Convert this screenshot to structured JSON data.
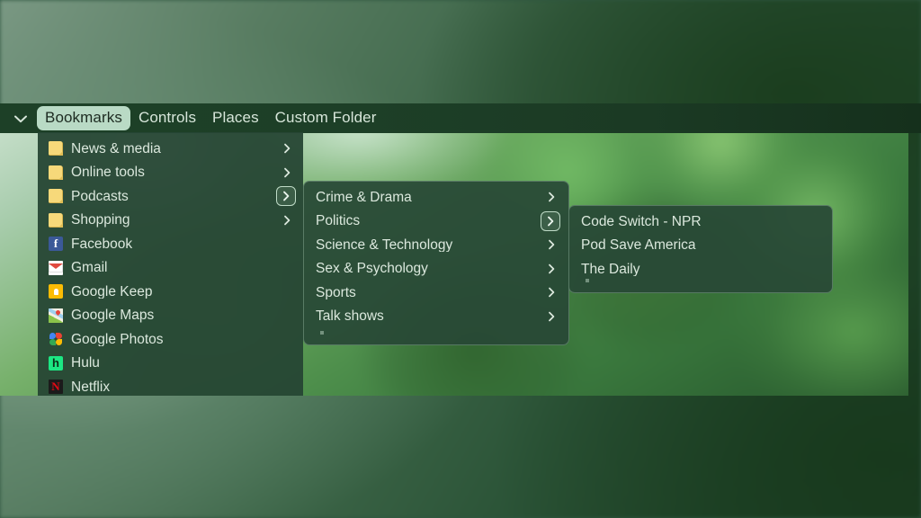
{
  "menubar": {
    "expander_icon": "chevron-down-icon",
    "tabs": [
      {
        "label": "Bookmarks",
        "active": true
      },
      {
        "label": "Controls",
        "active": false
      },
      {
        "label": "Places",
        "active": false
      },
      {
        "label": "Custom Folder",
        "active": false
      }
    ]
  },
  "menus": {
    "root": {
      "items": [
        {
          "label": "News & media",
          "icon": "folder-icon",
          "submenu": true,
          "focused": false
        },
        {
          "label": "Online tools",
          "icon": "folder-icon",
          "submenu": true,
          "focused": false
        },
        {
          "label": "Podcasts",
          "icon": "folder-icon",
          "submenu": true,
          "focused": true
        },
        {
          "label": "Shopping",
          "icon": "folder-icon",
          "submenu": true,
          "focused": false
        },
        {
          "label": "Facebook",
          "icon": "facebook-icon",
          "submenu": false,
          "focused": false
        },
        {
          "label": "Gmail",
          "icon": "gmail-icon",
          "submenu": false,
          "focused": false
        },
        {
          "label": "Google Keep",
          "icon": "google-keep-icon",
          "submenu": false,
          "focused": false
        },
        {
          "label": "Google Maps",
          "icon": "google-maps-icon",
          "submenu": false,
          "focused": false
        },
        {
          "label": "Google Photos",
          "icon": "google-photos-icon",
          "submenu": false,
          "focused": false
        },
        {
          "label": "Hulu",
          "icon": "hulu-icon",
          "submenu": false,
          "focused": false
        },
        {
          "label": "Netflix",
          "icon": "netflix-icon",
          "submenu": false,
          "focused": false
        }
      ]
    },
    "sub1": {
      "items": [
        {
          "label": "Crime & Drama",
          "submenu": true,
          "focused": false
        },
        {
          "label": "Politics",
          "submenu": true,
          "focused": true
        },
        {
          "label": "Science & Technology",
          "submenu": true,
          "focused": false
        },
        {
          "label": "Sex & Psychology",
          "submenu": true,
          "focused": false
        },
        {
          "label": "Sports",
          "submenu": true,
          "focused": false
        },
        {
          "label": "Talk shows",
          "submenu": true,
          "focused": false
        }
      ]
    },
    "sub2": {
      "items": [
        {
          "label": "Code Switch - NPR",
          "submenu": false,
          "focused": false
        },
        {
          "label": "Pod Save America",
          "submenu": false,
          "focused": false
        },
        {
          "label": "The Daily",
          "submenu": false,
          "focused": false
        }
      ]
    }
  },
  "colors": {
    "menubar_bg": "#1d4027",
    "panel_bg": "#284836",
    "active_tab_bg": "#b9dac5",
    "active_tab_text": "#1d2b21",
    "item_text": "#dbe8dd",
    "focus_ring": "#c0dcc8"
  }
}
